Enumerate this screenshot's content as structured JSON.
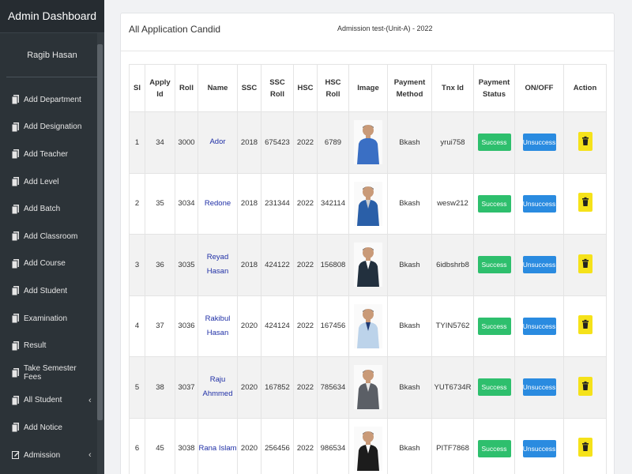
{
  "sidebar": {
    "title": "Admin Dashboard",
    "user": "Ragib Hasan",
    "items": [
      {
        "label": "Add Department",
        "icon": "file-icon",
        "chevron": ""
      },
      {
        "label": "Add Designation",
        "icon": "file-icon",
        "chevron": ""
      },
      {
        "label": "Add Teacher",
        "icon": "file-icon",
        "chevron": ""
      },
      {
        "label": "Add Level",
        "icon": "file-icon",
        "chevron": ""
      },
      {
        "label": "Add Batch",
        "icon": "file-icon",
        "chevron": ""
      },
      {
        "label": "Add Classroom",
        "icon": "file-icon",
        "chevron": ""
      },
      {
        "label": "Add Course",
        "icon": "file-icon",
        "chevron": ""
      },
      {
        "label": "Add Student",
        "icon": "file-icon",
        "chevron": ""
      },
      {
        "label": "Examination",
        "icon": "file-icon",
        "chevron": ""
      },
      {
        "label": "Result",
        "icon": "file-icon",
        "chevron": ""
      },
      {
        "label": "Take Semester Fees",
        "icon": "file-icon",
        "chevron": ""
      },
      {
        "label": "All Student",
        "icon": "file-icon",
        "chevron": "‹"
      },
      {
        "label": "Add Notice",
        "icon": "file-icon",
        "chevron": ""
      },
      {
        "label": "Admission",
        "icon": "edit-icon",
        "chevron": "‹"
      }
    ]
  },
  "card": {
    "title": "All Application Candid",
    "subtitle": "Admission test-(Unit-A) - 2022"
  },
  "table": {
    "headers": [
      {
        "key": "sl",
        "label": "Sl"
      },
      {
        "key": "apply_id",
        "label": "Apply Id"
      },
      {
        "key": "roll",
        "label": "Roll"
      },
      {
        "key": "name",
        "label": "Name"
      },
      {
        "key": "ssc",
        "label": "SSC"
      },
      {
        "key": "ssc_roll",
        "label": "SSC Roll"
      },
      {
        "key": "hsc",
        "label": "HSC"
      },
      {
        "key": "hsc_roll",
        "label": "HSC Roll"
      },
      {
        "key": "image",
        "label": "Image"
      },
      {
        "key": "payment_method",
        "label": "Payment Method"
      },
      {
        "key": "tnx_id",
        "label": "Tnx Id"
      },
      {
        "key": "payment_status",
        "label": "Payment Status"
      },
      {
        "key": "on_off",
        "label": "ON/OFF"
      },
      {
        "key": "action",
        "label": "Action"
      }
    ],
    "rows": [
      {
        "sl": "1",
        "apply_id": "34",
        "roll": "3000",
        "name": "Ador",
        "ssc": "2018",
        "ssc_roll": "675423",
        "hsc": "2022",
        "hsc_roll": "6789",
        "photo": "person-photo-blue-polo",
        "payment_method": "Bkash",
        "tnx_id": "yrui758",
        "status_btn": "Success",
        "toggle_btn": "Unsuccess"
      },
      {
        "sl": "2",
        "apply_id": "35",
        "roll": "3034",
        "name": "Redone",
        "ssc": "2018",
        "ssc_roll": "231344",
        "hsc": "2022",
        "hsc_roll": "342114",
        "photo": "person-photo-phone",
        "payment_method": "Bkash",
        "tnx_id": "wesw212",
        "status_btn": "Success",
        "toggle_btn": "Unsuccess"
      },
      {
        "sl": "3",
        "apply_id": "36",
        "roll": "3035",
        "name": "Reyad Hasan",
        "ssc": "2018",
        "ssc_roll": "424122",
        "hsc": "2022",
        "hsc_roll": "156808",
        "photo": "person-photo-suit",
        "payment_method": "Bkash",
        "tnx_id": "6idbshrb8",
        "status_btn": "Success",
        "toggle_btn": "Unsuccess"
      },
      {
        "sl": "4",
        "apply_id": "37",
        "roll": "3036",
        "name": "Rakibul Hasan",
        "ssc": "2020",
        "ssc_roll": "424124",
        "hsc": "2022",
        "hsc_roll": "167456",
        "photo": "person-photo-shirt-tie",
        "payment_method": "Bkash",
        "tnx_id": "TYIN5762",
        "status_btn": "Success",
        "toggle_btn": "Unsuccess"
      },
      {
        "sl": "5",
        "apply_id": "38",
        "roll": "3037",
        "name": "Raju Ahmmed",
        "ssc": "2020",
        "ssc_roll": "167852",
        "hsc": "2022",
        "hsc_roll": "785634",
        "photo": "person-photo-grey-suit",
        "payment_method": "Bkash",
        "tnx_id": "YUT6734R",
        "status_btn": "Success",
        "toggle_btn": "Unsuccess"
      },
      {
        "sl": "6",
        "apply_id": "45",
        "roll": "3038",
        "name": "Rana Islam",
        "ssc": "2020",
        "ssc_roll": "256456",
        "hsc": "2022",
        "hsc_roll": "986534",
        "photo": "person-photo-black-suit",
        "payment_method": "Bkash",
        "tnx_id": "PITF7868",
        "status_btn": "Success",
        "toggle_btn": "Unsuccess"
      }
    ]
  },
  "colors": {
    "sidebar_bg": "#2c3338",
    "success": "#2ebf6d",
    "unsuccess": "#2a8be0",
    "delete": "#f5e21a",
    "name_link": "#1f2fa6"
  }
}
